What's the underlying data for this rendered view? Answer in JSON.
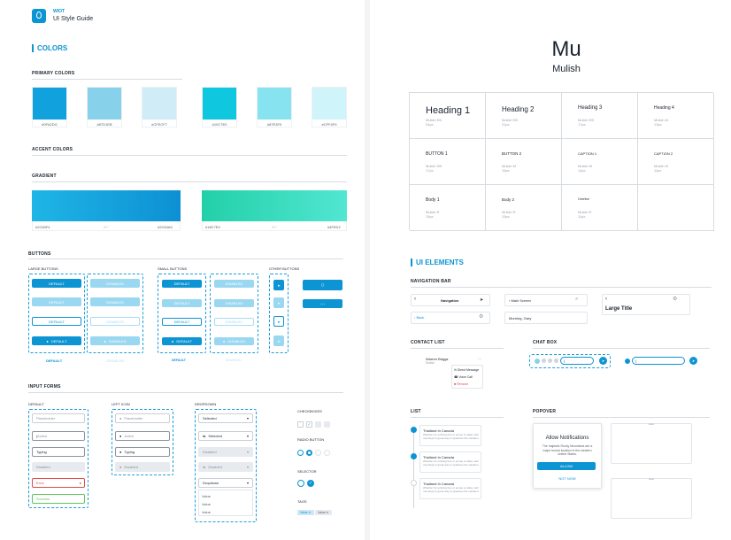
{
  "header": {
    "brand": "WIOT",
    "title": "UI Style Guide"
  },
  "colors": {
    "title": "COLORS",
    "primary_title": "PRIMARY COLORS",
    "primary": [
      {
        "hex": "#0FA2DG",
        "color": "#11a1dc"
      },
      {
        "hex": "#87D1EB",
        "color": "#87d1eb"
      },
      {
        "hex": "#CFECF7",
        "color": "#cfecf7"
      },
      {
        "hex": "#10C7E0",
        "color": "#10c7e0"
      },
      {
        "hex": "#87E3F0",
        "color": "#87e3f0"
      },
      {
        "hex": "#CFF4F9",
        "color": "#cff4f9"
      }
    ],
    "accent_title": "ACCENT COLORS",
    "gradient_title": "GRADIENT",
    "gradients": [
      {
        "from_label": "#2C80F4",
        "mid_label": "90°",
        "to_label": "#2C84A5",
        "from": "#1fb5e6",
        "to": "#0d90d3"
      },
      {
        "from_label": "#18C7E0",
        "mid_label": "90°",
        "to_label": "#4FED2",
        "from": "#22d0a8",
        "to": "#52e6d2"
      }
    ]
  },
  "buttons": {
    "title": "BUTTONS",
    "large_title": "LARGE BUTTONS",
    "small_title": "SMALL BUTTONS",
    "other_title": "OTHER BUTTONS",
    "default": "DEFAULT",
    "disabled": "DISABLED",
    "text_default": "DEFAULT",
    "text_disabled": "DISABLED",
    "dots": "...",
    "circle_glyph": "○"
  },
  "inputs": {
    "title": "INPUT FORMS",
    "default_title": "DEFAULT",
    "left_icon_title": "LEFT ICON",
    "dropdown_title": "DROPDOWN",
    "placeholder": "Placeholder",
    "active": "Active",
    "typing": "Typing",
    "disabled": "Disabled",
    "error": "Error",
    "success": "Success",
    "selected": "Selected",
    "dropdown": "Dropdown",
    "option": "Value",
    "checkboxes_title": "CHECKBOXES",
    "radio_title": "RADIO BUTTON",
    "selector_title": "SELECTOR",
    "tags_title": "TAGS",
    "tag": "Value"
  },
  "typography": {
    "big": "Mu",
    "family": "Mulish",
    "rows": [
      [
        {
          "name": "Heading 1",
          "meta1": "Mulish EB",
          "meta2": "24px"
        },
        {
          "name": "Heading 2",
          "meta1": "Mulish EB",
          "meta2": "21px"
        },
        {
          "name": "Heading 3",
          "meta1": "Mulish EB",
          "meta2": "17px"
        },
        {
          "name": "Heading 4",
          "meta1": "Mulish M",
          "meta2": "13px"
        }
      ],
      [
        {
          "name": "BUTTON 1",
          "meta1": "Mulish SB",
          "meta2": "17px"
        },
        {
          "name": "BUTTON 2",
          "meta1": "Mulish M",
          "meta2": "15px"
        },
        {
          "name": "CAPTION 1",
          "meta1": "Mulish M",
          "meta2": "14px"
        },
        {
          "name": "CAPTION 2",
          "meta1": "Mulish M",
          "meta2": "11px"
        }
      ],
      [
        {
          "name": "Body 1",
          "meta1": "Mulish R",
          "meta2": "15px"
        },
        {
          "name": "Body 2",
          "meta1": "Mulish R",
          "meta2": "13px"
        },
        {
          "name": "Overline",
          "meta1": "Mulish R",
          "meta2": "11px"
        },
        {
          "name": "",
          "meta1": "",
          "meta2": ""
        }
      ]
    ]
  },
  "ui": {
    "title": "UI ELEMENTS",
    "navbar_title": "NAVIGATION BAR",
    "nav1": "Navigation",
    "nav2": "Main Screen",
    "back": "Back",
    "morning": "Morning, Gary",
    "large_title": "Large Title",
    "contact_title": "CONTACT LIST",
    "contact_name": "Warren Briggs",
    "contact_sub": "Mulish",
    "menu": [
      "Direct Message",
      "Voice Call",
      "Remove"
    ],
    "chat_title": "CHAT BOX",
    "list_title": "LIST",
    "list_items": [
      {
        "title": "Thailand In Canada",
        "body": "Whether for enticing bus or ensue or allow, laid moorings to great way to spacious the vacation."
      },
      {
        "title": "Thailand In Canada",
        "body": "Whether for enticing bus or ensue or allow, laid moorings to great way to spacious the vacation."
      },
      {
        "title": "Thailand In Canada",
        "body": "Whether for enticing bus or ensue or allow, laid moorings to great way to spacious the vacation."
      }
    ],
    "popover_title": "POPOVER",
    "popover_heading": "Allow Notifications",
    "popover_body": "The majestic Rocky Mountains are a major tourist location in the western United States.",
    "allow": "ALLOW",
    "not_now": "NOT NOW"
  }
}
